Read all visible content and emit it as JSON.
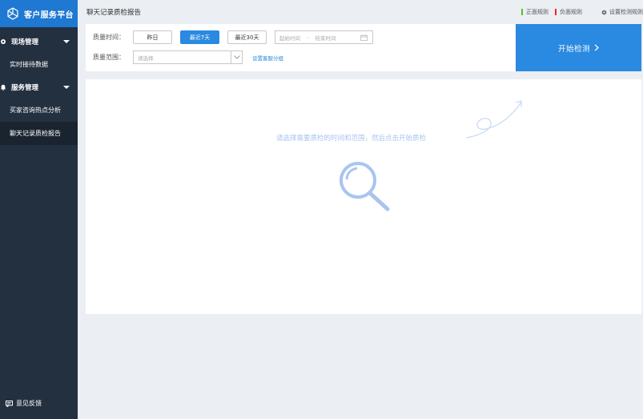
{
  "sidebar": {
    "brand": "客户服务平台",
    "groups": [
      {
        "label": "现场管理",
        "icon": "gear-icon",
        "items": [
          {
            "label": "实时接待数据",
            "active": false
          }
        ]
      },
      {
        "label": "服务管理",
        "icon": "bell-icon",
        "items": [
          {
            "label": "买家咨询热点分析",
            "active": false
          },
          {
            "label": "聊天记录质检报告",
            "active": true
          }
        ]
      }
    ],
    "feedback": "意见反馈"
  },
  "header": {
    "title": "聊天记录质检报告",
    "rules": [
      {
        "label": "正面规则",
        "color": "#52c41a"
      },
      {
        "label": "负面规则",
        "color": "#f5222d"
      }
    ],
    "settings": "设置检测规则"
  },
  "filter": {
    "time_label": "质量时间：",
    "buttons": [
      "昨日",
      "最近7天",
      "最近30天"
    ],
    "selected_button": "最近7天",
    "start_placeholder": "起始时间",
    "separator": "-",
    "end_placeholder": "结束时间",
    "scope_label": "质量范围：",
    "scope_placeholder": "请选择",
    "group_link": "设置客服分组"
  },
  "start_button": "开始检测",
  "main": {
    "hint": "请选择需要质检的时间和范围，然后点击开始质检"
  },
  "colors": {
    "accent": "#2a89e0",
    "sidebar": "#233040",
    "brand": "#1f78d1"
  }
}
